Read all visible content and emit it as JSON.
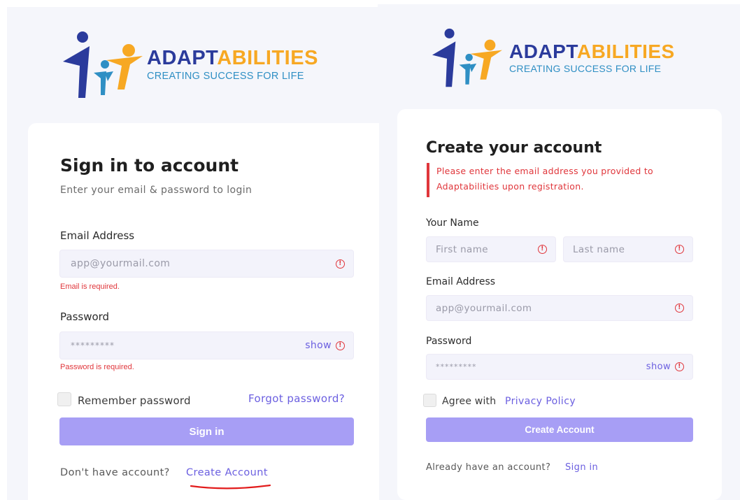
{
  "brand": {
    "name_part1": "ADAPT",
    "name_part2": "ABILITIES",
    "tagline": "CREATING SUCCESS FOR LIFE",
    "colors": {
      "blue": "#2b3b9c",
      "orange": "#f7a823",
      "teal": "#2f8fc4"
    }
  },
  "signin": {
    "title": "Sign in to account",
    "subtitle": "Enter your email & password to login",
    "email_label": "Email Address",
    "email_placeholder": "app@yourmail.com",
    "email_error": "Email is required.",
    "password_label": "Password",
    "password_value": "*********",
    "show_label": "show",
    "password_error": "Password is required.",
    "remember_label": "Remember password",
    "forgot_label": "Forgot password?",
    "submit_label": "Sign in",
    "no_account_text": "Don't have account?",
    "create_link": "Create Account"
  },
  "signup": {
    "title": "Create your account",
    "alert": "Please enter the email address you provided to Adaptabilities upon registration.",
    "name_label": "Your Name",
    "first_placeholder": "First name",
    "last_placeholder": "Last name",
    "email_label": "Email Address",
    "email_placeholder": "app@yourmail.com",
    "password_label": "Password",
    "password_value": "*********",
    "show_label": "show",
    "agree_text": "Agree with",
    "privacy_link": "Privacy Policy",
    "submit_label": "Create Account",
    "have_account_text": "Already have an account?",
    "signin_link": "Sign in"
  },
  "icons": {
    "error": "exclamation-circle-icon",
    "brand": "people-logo-icon"
  },
  "accent": "#6b5fe0",
  "button_color": "#a79ef5",
  "error_color": "#e0363b"
}
